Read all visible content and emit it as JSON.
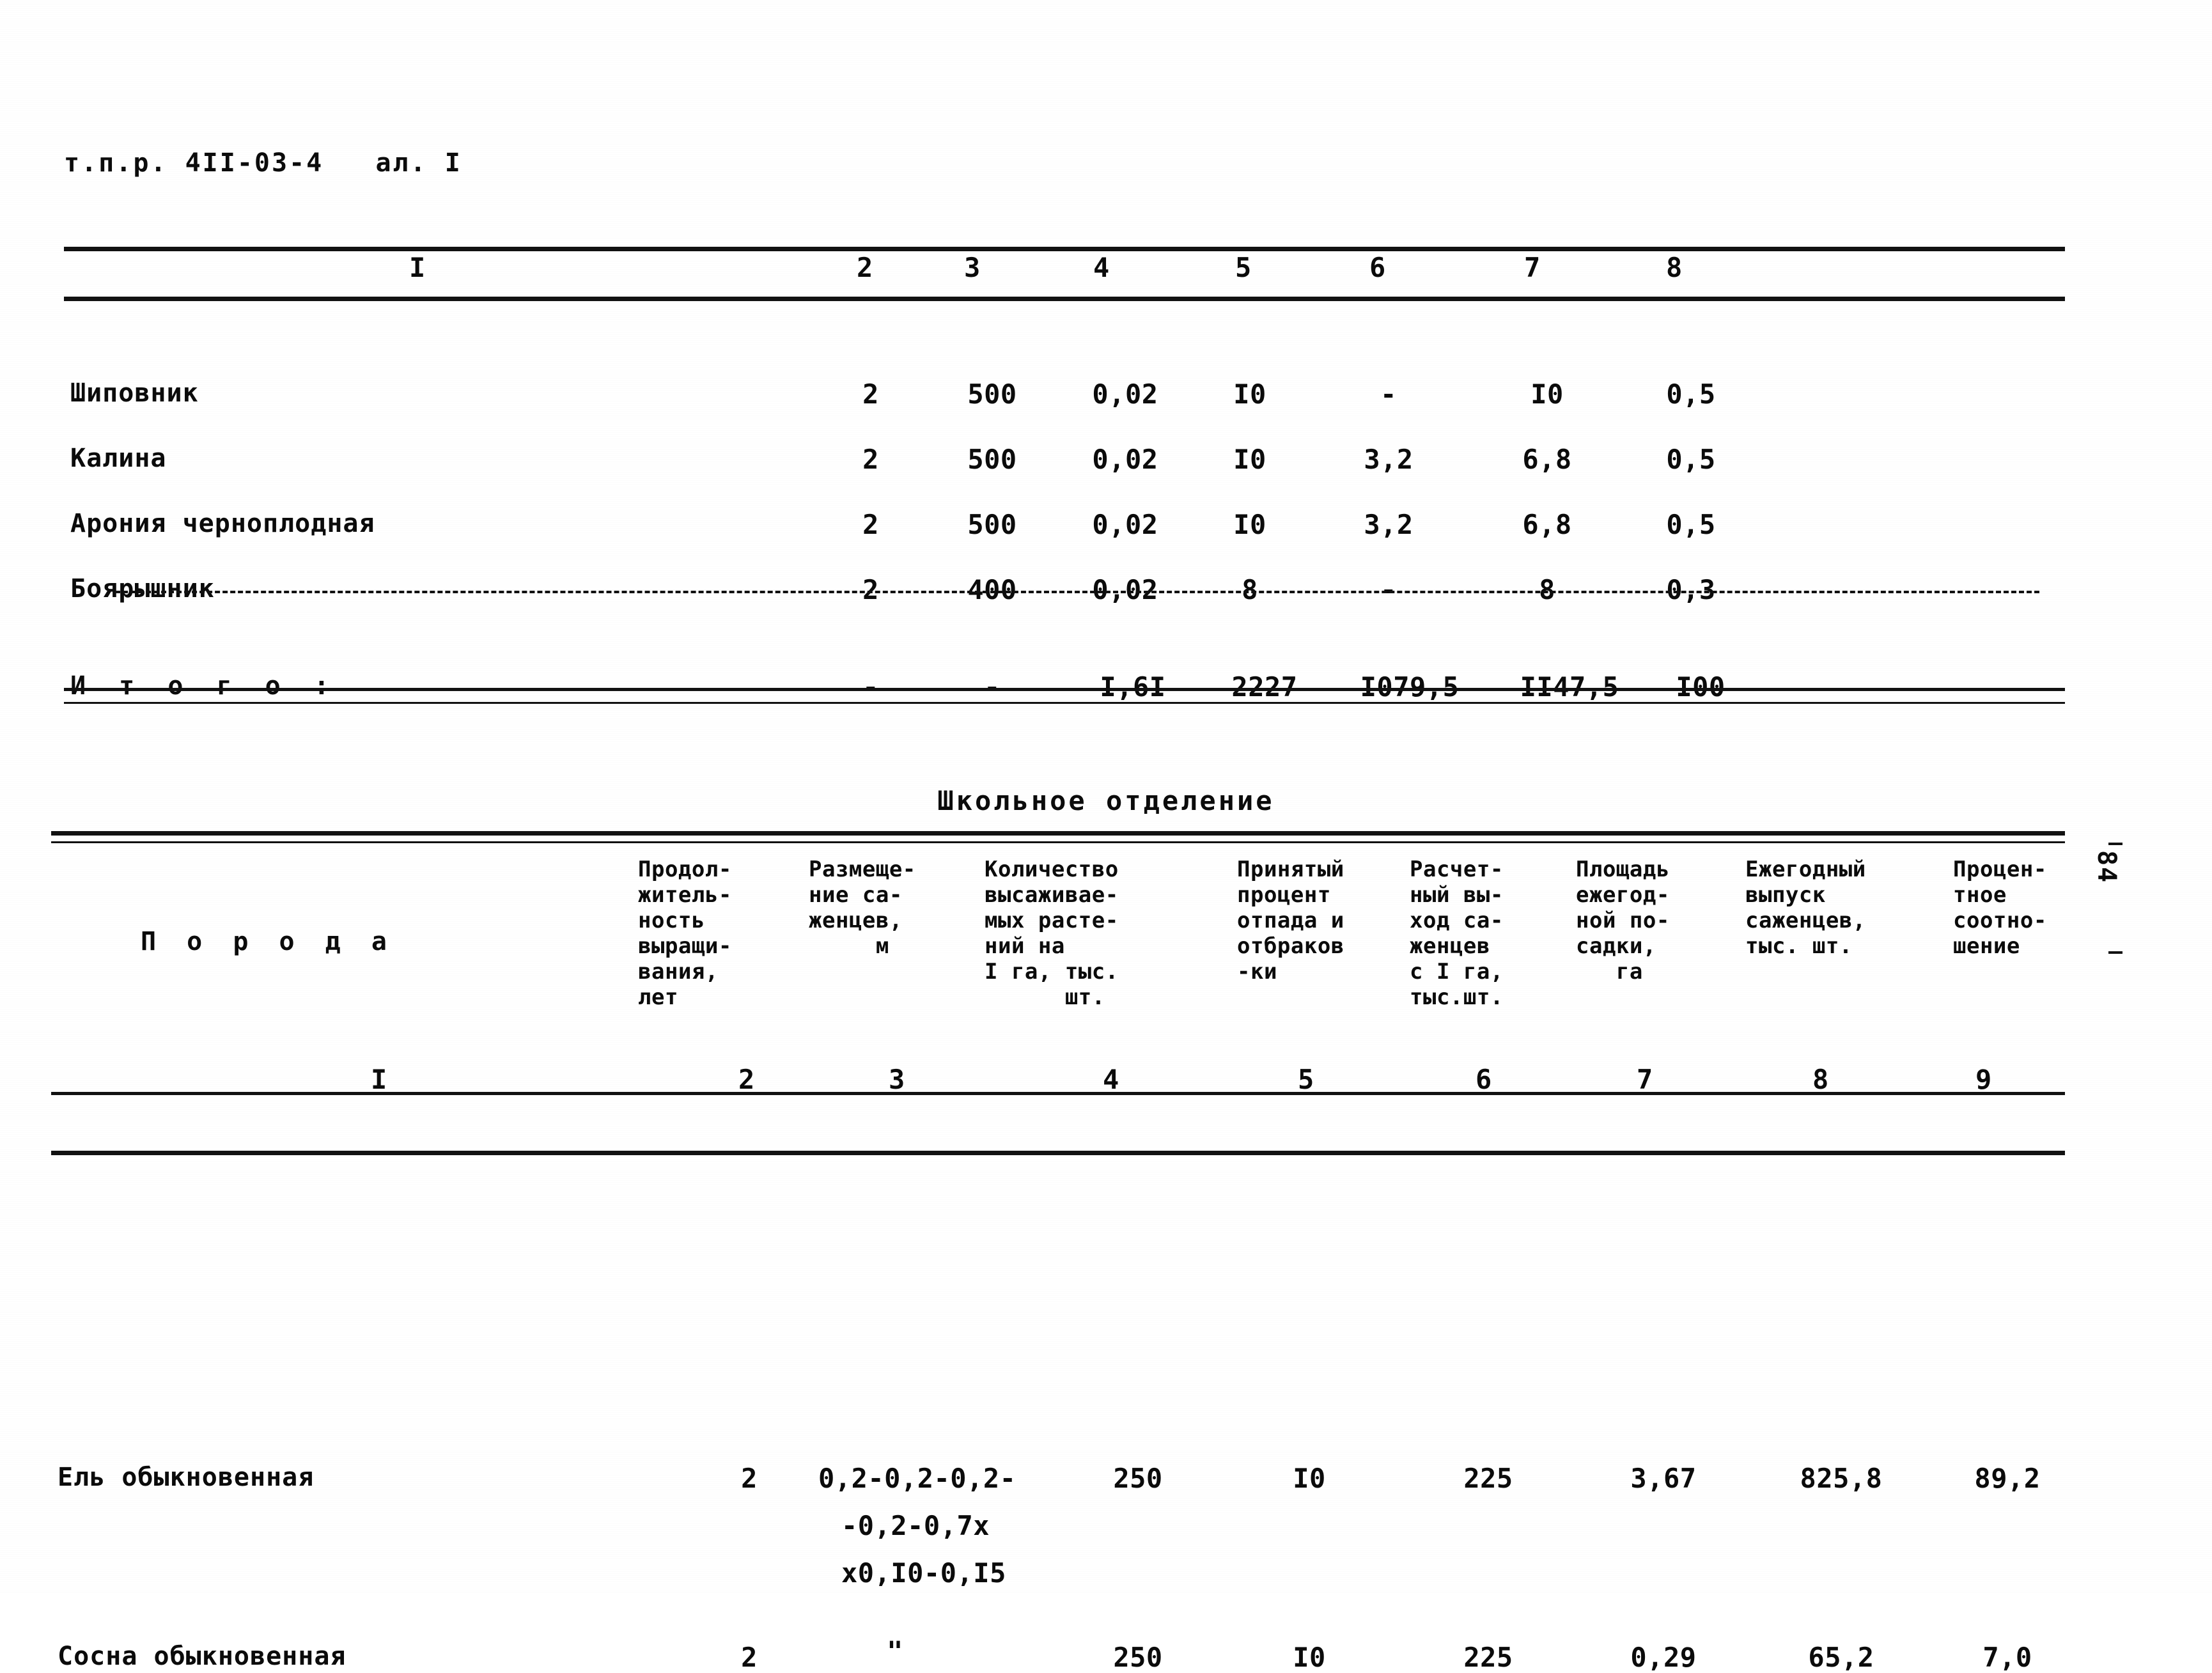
{
  "document": {
    "code_line": "т.п.р. 4II-03-4   ал. I",
    "margin_page_number": "84"
  },
  "table1": {
    "column_numbers": [
      "I",
      "2",
      "3",
      "4",
      "5",
      "6",
      "7",
      "8"
    ],
    "rows": [
      {
        "name": "Шиповник",
        "c2": "2",
        "c3": "500",
        "c4": "0,02",
        "c5": "I0",
        "c6": "-",
        "c7": "I0",
        "c8": "0,5"
      },
      {
        "name": "Калина",
        "c2": "2",
        "c3": "500",
        "c4": "0,02",
        "c5": "I0",
        "c6": "3,2",
        "c7": "6,8",
        "c8": "0,5"
      },
      {
        "name": "Арония черноплодная",
        "c2": "2",
        "c3": "500",
        "c4": "0,02",
        "c5": "I0",
        "c6": "3,2",
        "c7": "6,8",
        "c8": "0,5"
      },
      {
        "name": "Боярышник",
        "c2": "2",
        "c3": "400",
        "c4": "0,02",
        "c5": "8",
        "c6": "-",
        "c7": "8",
        "c8": "0,3"
      }
    ],
    "total_row": {
      "name": "И т о г о :",
      "c2": "",
      "c3": "-",
      "c4": "-",
      "c5": "I,6I",
      "c6": "2227",
      "c7": "I079,5",
      "c8": "II47,5",
      "c9": "I00"
    }
  },
  "section_title": "Школьное отделение",
  "table2": {
    "headers": {
      "col1": "П о р о д а",
      "col2": "Продол-\nжитель-\nность\nвыращи-\nвания,\nлет",
      "col3": "Размеще-\nние са-\nженцев,\n     м",
      "col4": "Количество\nвысаживае-\nмых расте-\nний на\nI га, тыс.\n      шт.",
      "col5": "Принятый\nпроцент\nотпада и\nотбраков\n-ки",
      "col6": "Расчет-\nный вы-\nход са-\nженцев\nс I га,\nтыс.шт.",
      "col7": "Площадь\nежегод-\nной по-\nсадки,\n   га",
      "col8": "Ежегодный\nвыпуск\nсаженцев,\nтыс. шт.",
      "col9": "Процен-\nтное\nсоотно-\nшение"
    },
    "column_numbers": [
      "I",
      "2",
      "3",
      "4",
      "5",
      "6",
      "7",
      "8",
      "9"
    ],
    "rows": [
      {
        "name": "Ель обыкновенная",
        "c2": "2",
        "c3_line1": "0,2-0,2-0,2-",
        "c3_line2": "-0,2-0,7х",
        "c3_line3": "х0,I0-0,I5",
        "c4": "250",
        "c5": "I0",
        "c6": "225",
        "c7": "3,67",
        "c8": "825,8",
        "c9": "89,2"
      },
      {
        "name": "Сосна обыкновенная",
        "c2": "2",
        "c3_line1": "\"",
        "c3_line2": "",
        "c3_line3": "",
        "c4": "250",
        "c5": "I0",
        "c6": "225",
        "c7": "0,29",
        "c8": "65,2",
        "c9": "7,0"
      }
    ]
  }
}
